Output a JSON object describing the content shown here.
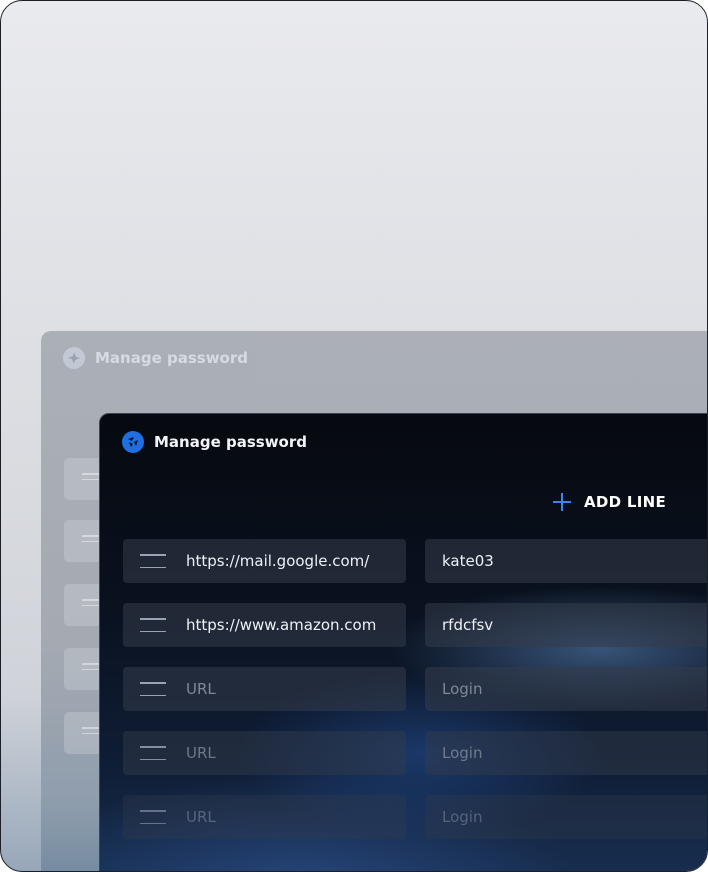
{
  "back_window": {
    "title": "Manage password"
  },
  "window": {
    "title": "Manage password",
    "add_line_label": "ADD LINE"
  },
  "rows": [
    {
      "url": "https://mail.google.com/",
      "login": "kate03",
      "url_placeholder": "URL",
      "login_placeholder": "Login"
    },
    {
      "url": "https://www.amazon.com",
      "login": "rfdcfsv",
      "url_placeholder": "URL",
      "login_placeholder": "Login"
    },
    {
      "url": "",
      "login": "",
      "url_placeholder": "URL",
      "login_placeholder": "Login"
    },
    {
      "url": "",
      "login": "",
      "url_placeholder": "URL",
      "login_placeholder": "Login"
    },
    {
      "url": "",
      "login": "",
      "url_placeholder": "URL",
      "login_placeholder": "Login"
    }
  ],
  "icons": {
    "logo": "app-logo-icon",
    "add": "plus-icon",
    "drag": "drag-handle-icon"
  },
  "colors": {
    "accent": "#1f6fe0",
    "window_bg": "#0a1220",
    "cell_bg": "#343c4a"
  }
}
